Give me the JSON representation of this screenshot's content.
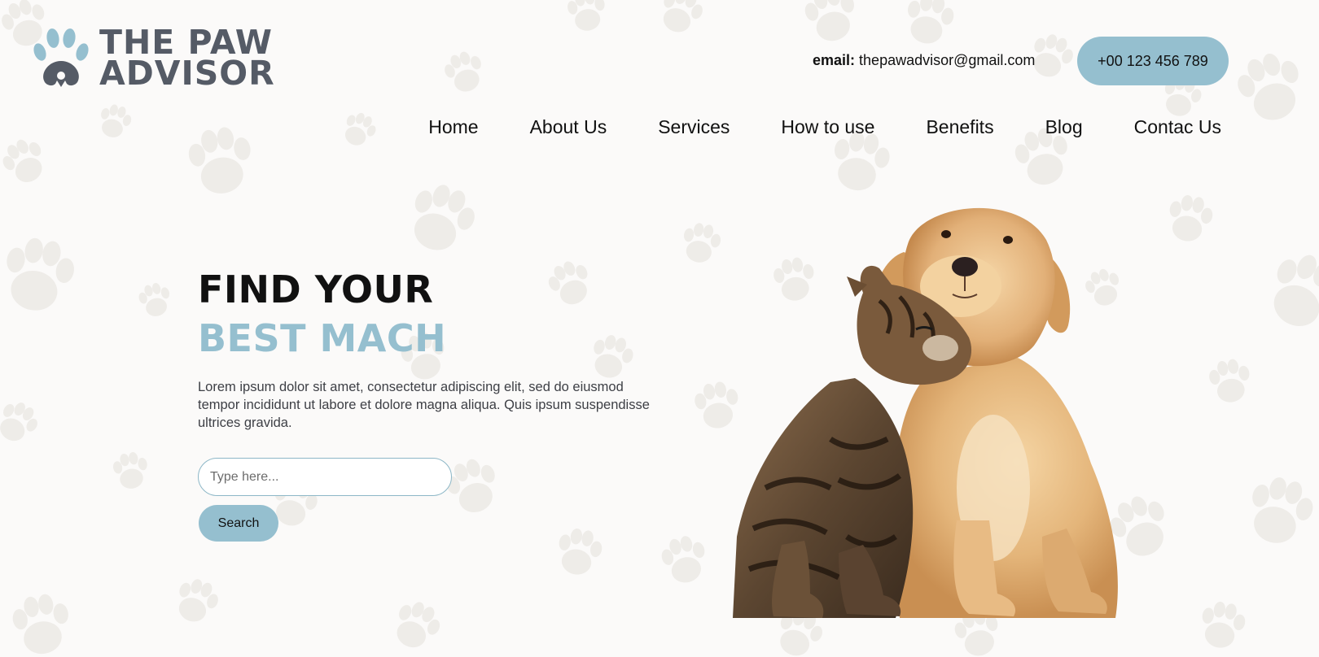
{
  "brand": {
    "line1": "THE PAW",
    "line2": "ADVISOR",
    "logo_icon": "paw-icon",
    "colors": {
      "accent": "#95bfcf",
      "logo_text": "#555b66"
    }
  },
  "contact": {
    "email_label": "email:",
    "email_value": "thepawadvisor@gmail.com",
    "phone": "+00 123 456 789"
  },
  "nav": {
    "items": [
      {
        "label": "Home"
      },
      {
        "label": "About Us"
      },
      {
        "label": "Services"
      },
      {
        "label": "How to use"
      },
      {
        "label": "Benefits"
      },
      {
        "label": "Blog"
      },
      {
        "label": "Contac Us"
      }
    ]
  },
  "hero": {
    "title_line1": "FIND YOUR",
    "title_line2": "BEST MACH",
    "description": "Lorem ipsum dolor sit amet, consectetur adipiscing elit, sed do eiusmod tempor incididunt ut labore et dolore magna aliqua. Quis ipsum suspendisse ultrices gravida.",
    "search": {
      "placeholder": "Type here...",
      "value": "",
      "button_label": "Search"
    },
    "image_icon": "kitten-and-puppy-image"
  }
}
